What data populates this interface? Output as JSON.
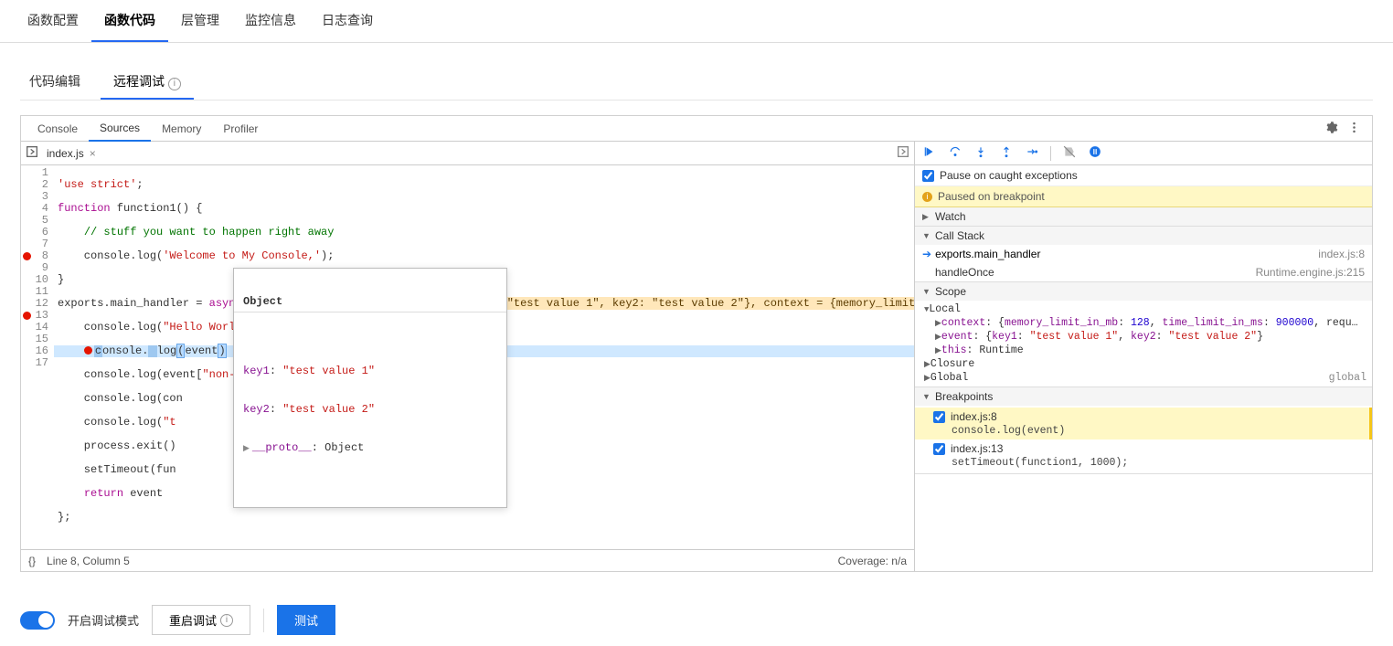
{
  "topTabs": [
    "函数配置",
    "函数代码",
    "层管理",
    "监控信息",
    "日志查询"
  ],
  "subTabs": [
    "代码编辑",
    "远程调试"
  ],
  "devtoolsTabs": [
    "Console",
    "Sources",
    "Memory",
    "Profiler"
  ],
  "fileTab": {
    "name": "index.js",
    "closable": "×"
  },
  "code": {
    "lines": [
      {
        "n": 1,
        "raw": "'use strict';"
      },
      {
        "n": 2,
        "raw": "function function1() {"
      },
      {
        "n": 3,
        "raw": "    // stuff you want to happen right away"
      },
      {
        "n": 4,
        "raw": "    console.log('Welcome to My Console,');"
      },
      {
        "n": 5,
        "raw": "}"
      },
      {
        "n": 6,
        "raw": "exports.main_handler = async (event, context) => {",
        "hint": "event = {key1: \"test value 1\", key2: \"test value 2\"}, context = {memory_limit"
      },
      {
        "n": 7,
        "raw": "    console.log(\"Hello World\")"
      },
      {
        "n": 8,
        "raw": "    console.log(event)",
        "bp": true,
        "active": true
      },
      {
        "n": 9,
        "raw": "    console.log(event[\"non-exist\"])"
      },
      {
        "n": 10,
        "raw": "    console.log(con"
      },
      {
        "n": 11,
        "raw": "    console.log(\"t"
      },
      {
        "n": 12,
        "raw": "    process.exit()"
      },
      {
        "n": 13,
        "raw": "    setTimeout(fun",
        "bp": true
      },
      {
        "n": 14,
        "raw": "    return event"
      },
      {
        "n": 15,
        "raw": "};"
      },
      {
        "n": 16,
        "raw": ""
      },
      {
        "n": 17,
        "raw": ""
      }
    ]
  },
  "tooltip": {
    "title": "Object",
    "props": [
      {
        "k": "key1",
        "v": "\"test value 1\""
      },
      {
        "k": "key2",
        "v": "\"test value 2\""
      }
    ],
    "proto": "__proto__",
    "protoVal": "Object"
  },
  "statusBar": {
    "pos": "Line 8, Column 5",
    "coverage": "Coverage: n/a"
  },
  "rightPane": {
    "pauseCaught": "Pause on caught exceptions",
    "pausedBanner": "Paused on breakpoint",
    "sections": {
      "watch": "Watch",
      "callstack": "Call Stack",
      "scope": "Scope",
      "breakpoints": "Breakpoints"
    },
    "callstack": [
      {
        "name": "exports.main_handler",
        "loc": "index.js:8",
        "active": true
      },
      {
        "name": "handleOnce",
        "loc": "Runtime.engine.js:215"
      }
    ],
    "scope": {
      "local": "Local",
      "localVars": [
        {
          "name": "context",
          "val": "{memory_limit_in_mb: 128, time_limit_in_ms: 900000, requ…",
          "mem": 128,
          "time": 900000
        },
        {
          "name": "event",
          "val": "{key1: \"test value 1\", key2: \"test value 2\"}"
        },
        {
          "name": "this",
          "val": "Runtime"
        }
      ],
      "closure": "Closure",
      "global": "Global",
      "globalVal": "global"
    },
    "breakpoints": [
      {
        "label": "index.js:8",
        "code": "console.log(event)",
        "hl": true
      },
      {
        "label": "index.js:13",
        "code": "setTimeout(function1, 1000);"
      }
    ]
  },
  "footer": {
    "toggleLabel": "开启调试模式",
    "restart": "重启调试",
    "test": "测试"
  }
}
